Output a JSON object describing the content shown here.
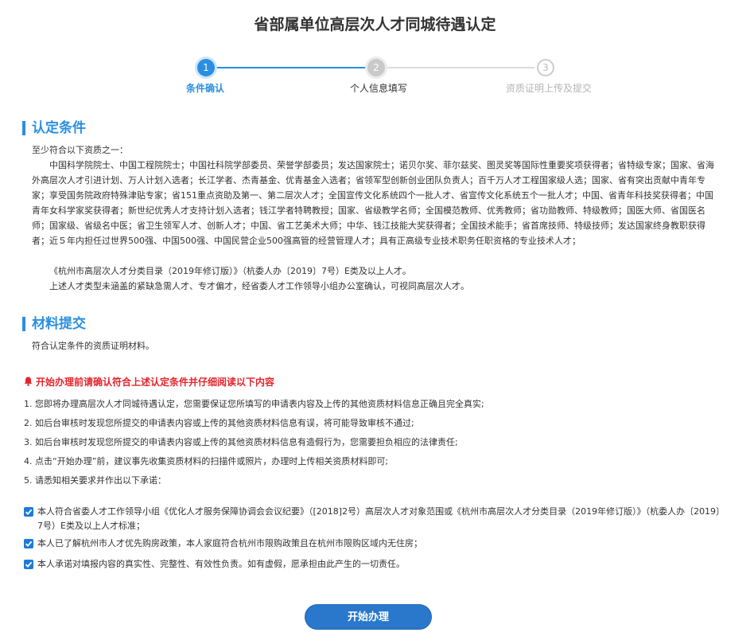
{
  "page": {
    "title": "省部属单位高层次人才同城待遇认定"
  },
  "steps": [
    {
      "number": "1",
      "label": "条件确认"
    },
    {
      "number": "2",
      "label": "个人信息填写"
    },
    {
      "number": "3",
      "label": "资质证明上传及提交"
    }
  ],
  "conditions": {
    "heading": "认定条件",
    "intro": "至少符合以下资质之一：",
    "body": "中国科学院院士、中国工程院院士；中国社科院学部委员、荣誉学部委员；发达国家院士；诺贝尔奖、菲尔兹奖、图灵奖等国际性重要奖项获得者；省特级专家；国家、省海外高层次人才引进计划、万人计划入选者；长江学者、杰青基金、优青基金入选者；省领军型创新创业团队负责人；百千万人才工程国家级人选；国家、省有突出贡献中青年专家；享受国务院政府特殊津贴专家；省151重点资助及第一、第二层次人才；全国宣传文化系统四个一批人才、省宣传文化系统五个一批人才；中国、省青年科技奖获得者；中国青年女科学家奖获得者；新世纪优秀人才支持计划入选者；钱江学者特聘教授；国家、省级教学名师；全国模范教师、优秀教师；省功勋教师、特级教师；国医大师、省国医名师；国家级、省级名中医；省卫生领军人才、创新人才；中国、省工艺美术大师；中华、钱江技能大奖获得者；全国技术能手；省首席技师、特级技师；发达国家终身教职获得者；近５年内担任过世界500强、中国500强、中国民营企业500强高管的经营管理人才；具有正高级专业技术职务任职资格的专业技术人才；",
    "catalog": "《杭州市高层次人才分类目录（2019年修订版）》（杭委人办〔2019〕7号）E类及以上人才。",
    "note": "上述人才类型未涵盖的紧缺急需人才、专才偏才，经省委人才工作领导小组办公室确认，可视同高层次人才。"
  },
  "materials": {
    "heading": "材料提交",
    "text": "符合认定条件的资质证明材料。"
  },
  "notice": {
    "warning": "开始办理前请确认符合上述认定条件并仔细阅读以下内容",
    "items": [
      "1. 您即将办理高层次人才同城待遇认定，您需要保证您所填写的申请表内容及上传的其他资质材料信息正确且完全真实;",
      "2. 如后台审核时发现您所提交的申请表内容或上传的其他资质材料信息有误，将可能导致审核不通过;",
      "3. 如后台审核时发现您所提交的申请表内容或上传的其他资质材料信息有造假行为，您需要担负相应的法律责任;",
      "4. 点击“开始办理”前，建议事先收集资质材料的扫描件或照片，办理时上传相关资质材料即可;",
      "5. 请悉知相关要求并作出以下承诺："
    ]
  },
  "pledges": [
    {
      "text": "本人符合省委人才工作领导小组《优化人才服务保障协调会会议纪要》（[2018]2号）高层次人才对象范围或《杭州市高层次人才分类目录（2019年修订版）》（杭委人办〔2019〕7号）E类及以上人才标准；",
      "checked": true
    },
    {
      "text": "本人已了解杭州市人才优先购房政策，本人家庭符合杭州市限购政策且在杭州市限购区域内无住房；",
      "checked": true
    },
    {
      "text": "本人承诺对填报内容的真实性、完整性、有效性负责。如有虚假，愿承担由此产生的一切责任。",
      "checked": true
    }
  ],
  "actions": {
    "start_label": "开始办理"
  },
  "colors": {
    "accent": "#2a8fe0",
    "warning": "#e4252c",
    "button": "#2a78cc"
  }
}
